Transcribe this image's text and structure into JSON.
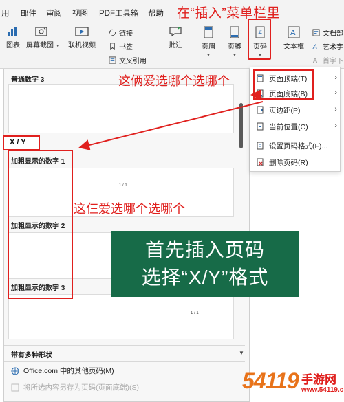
{
  "menubar": {
    "items": [
      "用",
      "邮件",
      "审阅",
      "视图",
      "PDF工具箱",
      "帮助"
    ],
    "note": "在“插入”菜单栏里"
  },
  "ribbon": {
    "chart": "图表",
    "screenshot": "屏幕截图",
    "video": "联机视频",
    "link": "链接",
    "bookmark": "书签",
    "crossref": "交叉引用",
    "comment": "批注",
    "header": "页眉",
    "footer": "页脚",
    "pagenum": "页码",
    "textbox": "文本框",
    "docparts": "文档部",
    "wordart": "艺术字",
    "dropcap": "首字下"
  },
  "gallery": {
    "plain3": "普通数字 3",
    "xy": "X / Y",
    "bold1": "加粗显示的数字 1",
    "bold2": "加粗显示的数字 2",
    "bold3": "加粗显示的数字 3",
    "sample_num": "1 / 1",
    "multi_shape": "带有多种形状",
    "more_office": "Office.com 中的其他页码(M)",
    "save_selection": "将所选内容另存为页码(页面底端)(S)"
  },
  "dropdown": {
    "top": "页面顶端(T)",
    "bottom": "页面底端(B)",
    "margin": "页边距(P)",
    "current": "当前位置(C)",
    "format": "设置页码格式(F)...",
    "remove": "删除页码(R)"
  },
  "notes": {
    "pick_two": "这俩爱选哪个选哪个",
    "pick_three": "这仨爱选哪个选哪个",
    "callout_line1": "首先插入页码",
    "callout_line2": "选择“X/Y”格式"
  },
  "watermark": {
    "big": "54119",
    "small": "手游网",
    "url": "www.54119.cn"
  },
  "colors": {
    "annotation_red": "#e0201e",
    "callout_green": "#176b48",
    "icon_blue": "#2b6cb0"
  }
}
